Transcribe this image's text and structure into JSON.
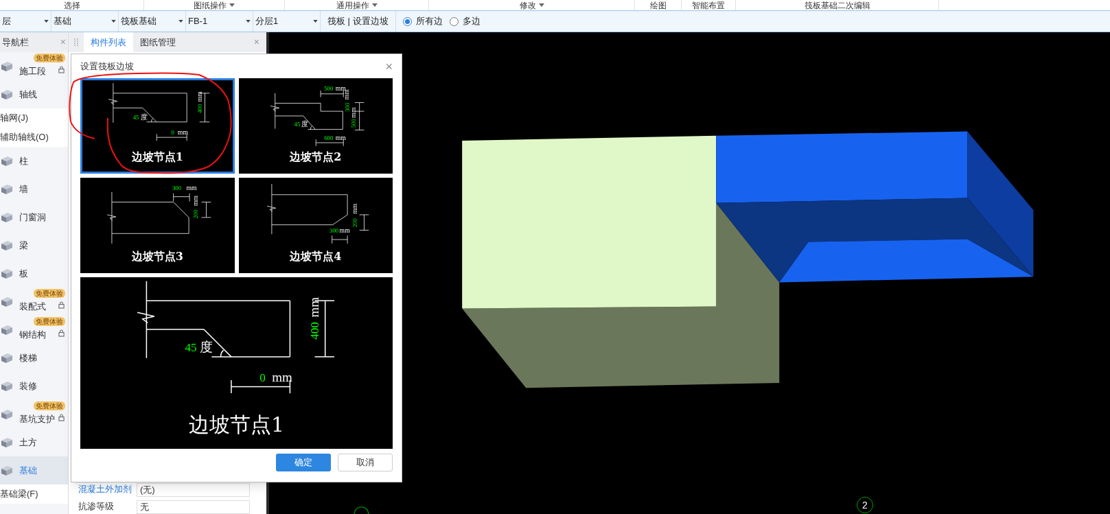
{
  "ribbon": [
    {
      "label": "选择",
      "has_menu": false
    },
    {
      "label": "图纸操作",
      "has_menu": true
    },
    {
      "label": "通用操作",
      "has_menu": true
    },
    {
      "label": "修改",
      "has_menu": true
    },
    {
      "label": "绘图",
      "has_menu": false
    },
    {
      "label": "智能布置",
      "has_menu": false
    },
    {
      "label": "筏板基础二次编辑",
      "has_menu": false
    }
  ],
  "toolbar": {
    "selectors": [
      {
        "value": "层"
      },
      {
        "value": "基础"
      },
      {
        "value": "筏板基础"
      },
      {
        "value": "FB-1"
      },
      {
        "value": "分层1"
      }
    ],
    "action": "筏板 | 设置边坡",
    "options": [
      {
        "label": "所有边",
        "selected": true
      },
      {
        "label": "多边",
        "selected": false
      }
    ]
  },
  "navigation": {
    "title": "导航栏",
    "close": "×",
    "items": [
      {
        "kind": "category",
        "label": "施工段",
        "badge": "免费体验",
        "selected": false
      },
      {
        "kind": "category",
        "label": "轴线",
        "selected": false
      },
      {
        "kind": "sub",
        "label": "轴网(J)",
        "selected": false
      },
      {
        "kind": "sub",
        "label": "辅助轴线(O)",
        "selected": false
      },
      {
        "kind": "category",
        "label": "柱",
        "selected": false
      },
      {
        "kind": "category",
        "label": "墙",
        "selected": false
      },
      {
        "kind": "category",
        "label": "门窗洞",
        "selected": false
      },
      {
        "kind": "category",
        "label": "梁",
        "selected": false
      },
      {
        "kind": "category",
        "label": "板",
        "selected": false
      },
      {
        "kind": "category",
        "label": "装配式",
        "badge": "免费体验",
        "selected": false
      },
      {
        "kind": "category",
        "label": "钢结构",
        "badge": "免费体验",
        "selected": false
      },
      {
        "kind": "category",
        "label": "楼梯",
        "selected": false
      },
      {
        "kind": "category",
        "label": "装修",
        "selected": false
      },
      {
        "kind": "category",
        "label": "基坑支护",
        "badge": "免费体验",
        "selected": false
      },
      {
        "kind": "category",
        "label": "土方",
        "selected": false
      },
      {
        "kind": "category",
        "label": "基础",
        "selected": true
      },
      {
        "kind": "sub",
        "label": "基础梁(F)",
        "selected": false
      }
    ]
  },
  "component_panel": {
    "close": "×",
    "tabs": [
      {
        "label": "构件列表",
        "selected": true
      },
      {
        "label": "图纸管理",
        "selected": false
      }
    ],
    "properties": [
      {
        "name": "混凝土外加剂",
        "value": "(无)",
        "linked": true
      },
      {
        "name": "抗渗等级",
        "value": "无",
        "linked": false
      }
    ]
  },
  "dialog": {
    "title": "设置筏板边坡",
    "close": "×",
    "options": [
      {
        "kind": "slope-bottom",
        "caption": "边坡节点1",
        "selected": true,
        "labels": [
          "45",
          "度",
          "400",
          "mm",
          "0",
          "mm"
        ]
      },
      {
        "kind": "step-slope",
        "caption": "边坡节点2",
        "selected": false,
        "labels": [
          "500",
          "mm",
          "mm",
          "300",
          "mm",
          "500",
          "45",
          "度",
          "600",
          "mm"
        ]
      },
      {
        "kind": "top-slope",
        "caption": "边坡节点3",
        "selected": false,
        "labels": [
          "300",
          "mm",
          "200",
          "mm"
        ]
      },
      {
        "kind": "bottom-slope",
        "caption": "边坡节点4",
        "selected": false,
        "labels": [
          "200",
          "mm",
          "300",
          "mm"
        ]
      }
    ],
    "preview": {
      "kind": "slope-bottom",
      "caption": "边坡节点1",
      "labels": [
        "45",
        "度",
        "400",
        "mm",
        "0",
        "mm"
      ]
    },
    "buttons": [
      {
        "label": "确定",
        "kind": "primary"
      },
      {
        "label": "取消",
        "kind": "secondary"
      }
    ]
  },
  "canvas": {
    "axis_marks": [
      {
        "label": "2"
      }
    ]
  }
}
